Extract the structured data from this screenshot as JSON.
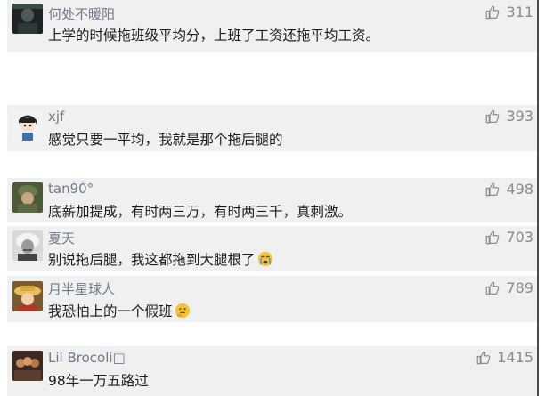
{
  "comments": [
    {
      "avatar": "dark-portrait-avatar",
      "name": "何处不暖阳",
      "text": "上学的时候拖班级平均分，上班了工资还拖平均工资。",
      "likes": "311",
      "emoji": ""
    },
    {
      "avatar": "cartoon-boy-avatar",
      "name": "xjf",
      "text": "感觉只要一平均，我就是那个拖后腿的",
      "likes": "393",
      "emoji": ""
    },
    {
      "avatar": "soldier-avatar",
      "name": "tan90°",
      "text": "底薪加提成，有时两三万，有时两三千，真刺激。",
      "likes": "498",
      "emoji": ""
    },
    {
      "avatar": "einstein-avatar",
      "name": "夏天",
      "text": "别说拖后腿，我这都拖到大腿根了",
      "likes": "703",
      "emoji": "crying-face-emoji"
    },
    {
      "avatar": "straw-hat-avatar",
      "name": "月半星球人",
      "text": "我恐怕上的一个假班",
      "likes": "789",
      "emoji": "thinking-face-emoji"
    },
    {
      "avatar": "group-photo-avatar",
      "name": "Lil Brocoli□",
      "text": "98年一万五路过",
      "likes": "1415",
      "emoji": ""
    }
  ],
  "icons": {
    "like": "thumbs-up-icon"
  },
  "colors": {
    "card_bg": "#f0f0f0",
    "name": "#6f7a88",
    "likes": "#8b8b8b"
  }
}
